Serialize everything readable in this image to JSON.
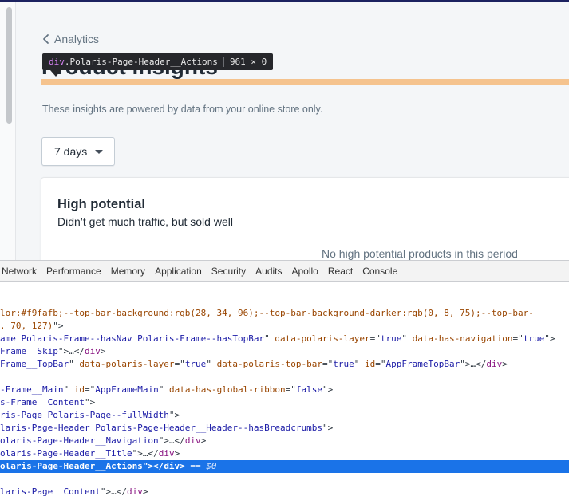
{
  "page": {
    "breadcrumb": "Analytics",
    "title": "Product insights",
    "subtitle": "These insights are powered by data from your online store only.",
    "period_select": "7 days",
    "card": {
      "title": "High potential",
      "description": "Didn’t get much traffic, but sold well",
      "empty_state": "No high potential products in this period"
    }
  },
  "inspector_tooltip": {
    "tag": "div",
    "class": ".Polaris-Page-Header__Actions",
    "dims": "961 × 0"
  },
  "devtools": {
    "tabs": [
      "Network",
      "Performance",
      "Memory",
      "Application",
      "Security",
      "Audits",
      "Apollo",
      "React",
      "Console"
    ],
    "lines": [
      {
        "parts": [
          [
            "t-attr",
            "lor:#f9fafb;--top-bar-background:rgb(28, 34, 96);--top-bar-background-darker:rgb(0, 8, 75);--top-bar-"
          ]
        ]
      },
      {
        "parts": [
          [
            "t-attr",
            ". 70, 127)"
          ],
          [
            "t-plain",
            "\">"
          ]
        ]
      },
      {
        "parts": [
          [
            "t-val",
            "ame Polaris-Frame--hasNav Polaris-Frame--hasTopBar"
          ],
          [
            "t-plain",
            "\" "
          ],
          [
            "t-attr",
            "data-polaris-layer"
          ],
          [
            "t-plain",
            "=\""
          ],
          [
            "t-val",
            "true"
          ],
          [
            "t-plain",
            "\" "
          ],
          [
            "t-attr",
            "data-has-navigation"
          ],
          [
            "t-plain",
            "=\""
          ],
          [
            "t-val",
            "true"
          ],
          [
            "t-plain",
            "\">"
          ]
        ]
      },
      {
        "parts": [
          [
            "t-val",
            "Frame__Skip"
          ],
          [
            "t-plain",
            "\">…</"
          ],
          [
            "t-tag",
            "div"
          ],
          [
            "t-plain",
            ">"
          ]
        ]
      },
      {
        "parts": [
          [
            "t-val",
            "Frame__TopBar"
          ],
          [
            "t-plain",
            "\" "
          ],
          [
            "t-attr",
            "data-polaris-layer"
          ],
          [
            "t-plain",
            "=\""
          ],
          [
            "t-val",
            "true"
          ],
          [
            "t-plain",
            "\" "
          ],
          [
            "t-attr",
            "data-polaris-top-bar"
          ],
          [
            "t-plain",
            "=\""
          ],
          [
            "t-val",
            "true"
          ],
          [
            "t-plain",
            "\" "
          ],
          [
            "t-attr",
            "id"
          ],
          [
            "t-plain",
            "=\""
          ],
          [
            "t-val",
            "AppFrameTopBar"
          ],
          [
            "t-plain",
            "\">…</"
          ],
          [
            "t-tag",
            "div"
          ],
          [
            "t-plain",
            ">"
          ]
        ]
      },
      {
        "parts": [
          [
            "t-plain",
            ""
          ]
        ]
      },
      {
        "parts": [
          [
            "t-val",
            "-Frame__Main"
          ],
          [
            "t-plain",
            "\" "
          ],
          [
            "t-attr",
            "id"
          ],
          [
            "t-plain",
            "=\""
          ],
          [
            "t-val",
            "AppFrameMain"
          ],
          [
            "t-plain",
            "\" "
          ],
          [
            "t-attr",
            "data-has-global-ribbon"
          ],
          [
            "t-plain",
            "=\""
          ],
          [
            "t-val",
            "false"
          ],
          [
            "t-plain",
            "\">"
          ]
        ]
      },
      {
        "parts": [
          [
            "t-val",
            "s-Frame__Content"
          ],
          [
            "t-plain",
            "\">"
          ]
        ]
      },
      {
        "parts": [
          [
            "t-val",
            "ris-Page Polaris-Page--fullWidth"
          ],
          [
            "t-plain",
            "\">"
          ]
        ]
      },
      {
        "parts": [
          [
            "t-val",
            "laris-Page-Header Polaris-Page-Header__Header--hasBreadcrumbs"
          ],
          [
            "t-plain",
            "\">"
          ]
        ]
      },
      {
        "parts": [
          [
            "t-val",
            "olaris-Page-Header__Navigation"
          ],
          [
            "t-plain",
            "\">…</"
          ],
          [
            "t-tag",
            "div"
          ],
          [
            "t-plain",
            ">"
          ]
        ]
      },
      {
        "parts": [
          [
            "t-val",
            "olaris-Page-Header__Title"
          ],
          [
            "t-plain",
            "\">…</"
          ],
          [
            "t-tag",
            "div"
          ],
          [
            "t-plain",
            ">"
          ]
        ]
      },
      {
        "selected": true,
        "parts": [
          [
            "t-val",
            "olaris-Page-Header__Actions"
          ],
          [
            "t-plain",
            "\"></"
          ],
          [
            "t-tag",
            "div"
          ],
          [
            "t-plain",
            ">"
          ],
          [
            "t-eq",
            " == $0"
          ]
        ]
      },
      {
        "parts": [
          [
            "t-plain",
            ""
          ]
        ]
      },
      {
        "parts": [
          [
            "t-val",
            "laris-Page__Content"
          ],
          [
            "t-plain",
            "\">…</"
          ],
          [
            "t-tag",
            "div"
          ],
          [
            "t-plain",
            ">"
          ]
        ]
      }
    ]
  }
}
